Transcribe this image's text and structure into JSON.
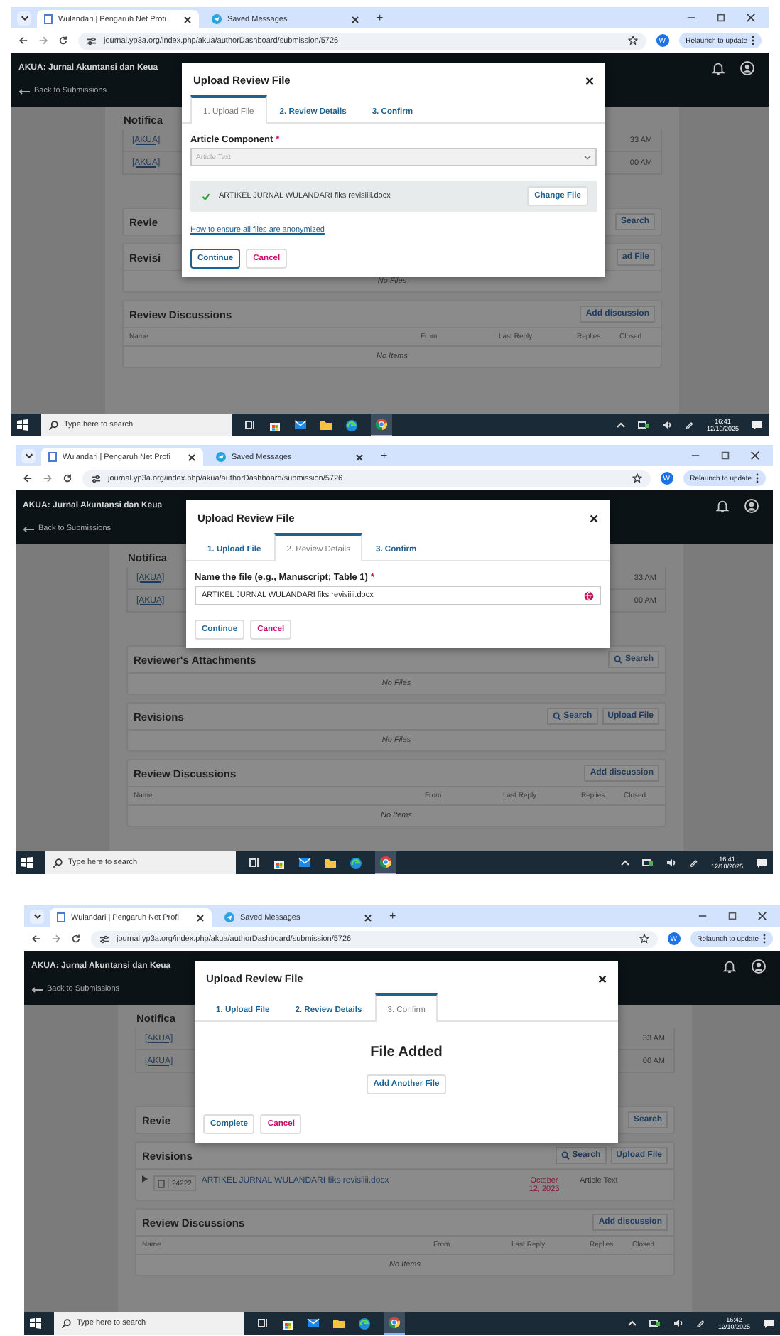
{
  "frames": [
    {
      "browser": {
        "tabs": [
          {
            "label": "Wulandari | Pengaruh Net Profi",
            "selected": true
          },
          {
            "label": "Saved Messages",
            "selected": false
          }
        ],
        "new_tab": "+",
        "url": "journal.yp3a.org/index.php/akua/authorDashboard/submission/5726",
        "profile": "W",
        "update": "Relaunch to update"
      },
      "page": {
        "title": "AKUA: Jurnal Akuntansi dan Keua",
        "back": "Back to Submissions",
        "cards": [
          {
            "kind": "notifications",
            "title": "Notifica",
            "rows": [
              {
                "link": "[AKUA]",
                "time": "33 AM"
              },
              {
                "link": "[AKUA]",
                "time": "00 AM"
              }
            ]
          },
          {
            "kind": "files",
            "title": "Revie",
            "buttons": [
              {
                "label": "Search",
                "kind": "plain"
              }
            ]
          },
          {
            "kind": "files",
            "title": "Revisi",
            "buttons": [
              {
                "label": "ad File",
                "kind": "plain"
              }
            ],
            "empty": "No Files"
          },
          {
            "kind": "discussions",
            "title": "Review Discussions",
            "buttons": [
              {
                "label": "Add discussion",
                "kind": "plain"
              }
            ],
            "columns": [
              "Name",
              "From",
              "Last Reply",
              "Replies",
              "Closed"
            ],
            "empty": "No Items"
          }
        ]
      },
      "modal": {
        "title": "Upload Review File",
        "steps": [
          {
            "label": "1. Upload File",
            "selected": true
          },
          {
            "label": "2. Review Details",
            "selected": false
          },
          {
            "label": "3. Confirm",
            "selected": false
          }
        ],
        "body": [
          {
            "kind": "select",
            "label": "Article Component",
            "required": "*",
            "value": "Article Text"
          },
          {
            "kind": "file",
            "name": "ARTIKEL JURNAL WULANDARI fiks revisiiii.docx",
            "button": "Change File"
          },
          {
            "kind": "link",
            "text": "How to ensure all files are anonymized"
          }
        ],
        "actions": [
          {
            "label": "Continue",
            "kind": "primary",
            "focused": true
          },
          {
            "label": "Cancel",
            "kind": "cancel",
            "focused": false
          }
        ]
      },
      "taskbar": {
        "search": "Type here to search",
        "time": "16:41",
        "date": "12/10/2025"
      }
    },
    {
      "browser": {
        "tabs": [
          {
            "label": "Wulandari | Pengaruh Net Profi",
            "selected": true
          },
          {
            "label": "Saved Messages",
            "selected": false
          }
        ],
        "new_tab": "+",
        "url": "journal.yp3a.org/index.php/akua/authorDashboard/submission/5726",
        "profile": "W",
        "update": "Relaunch to update"
      },
      "page": {
        "title": "AKUA: Jurnal Akuntansi dan Keua",
        "back": "Back to Submissions",
        "cards": [
          {
            "kind": "notifications",
            "title": "Notifica",
            "rows": [
              {
                "link": "[AKUA]",
                "time": "33 AM"
              },
              {
                "link": "[AKUA]",
                "time": "00 AM"
              }
            ]
          },
          {
            "kind": "files",
            "title": "Reviewer's Attachments",
            "buttons": [
              {
                "label": "Search",
                "kind": "search"
              }
            ],
            "empty": "No Files"
          },
          {
            "kind": "files",
            "title": "Revisions",
            "buttons": [
              {
                "label": "Search",
                "kind": "search"
              },
              {
                "label": "Upload File",
                "kind": "plain"
              }
            ],
            "empty": "No Files"
          },
          {
            "kind": "discussions",
            "title": "Review Discussions",
            "buttons": [
              {
                "label": "Add discussion",
                "kind": "plain"
              }
            ],
            "columns": [
              "Name",
              "From",
              "Last Reply",
              "Replies",
              "Closed"
            ],
            "empty": "No Items"
          }
        ]
      },
      "modal": {
        "title": "Upload Review File",
        "steps": [
          {
            "label": "1. Upload File",
            "selected": false
          },
          {
            "label": "2. Review Details",
            "selected": true
          },
          {
            "label": "3. Confirm",
            "selected": false
          }
        ],
        "body": [
          {
            "kind": "input",
            "label": "Name the file (e.g., Manuscript; Table 1)",
            "required": "*",
            "value": "ARTIKEL JURNAL WULANDARI fiks revisiiii.docx"
          }
        ],
        "actions": [
          {
            "label": "Continue",
            "kind": "primary",
            "focused": false
          },
          {
            "label": "Cancel",
            "kind": "cancel",
            "focused": false
          }
        ]
      },
      "taskbar": {
        "search": "Type here to search",
        "time": "16:41",
        "date": "12/10/2025"
      }
    },
    {
      "browser": {
        "tabs": [
          {
            "label": "Wulandari | Pengaruh Net Profi",
            "selected": true
          },
          {
            "label": "Saved Messages",
            "selected": false
          }
        ],
        "new_tab": "+",
        "url": "journal.yp3a.org/index.php/akua/authorDashboard/submission/5726",
        "profile": "W",
        "update": "Relaunch to update"
      },
      "page": {
        "title": "AKUA: Jurnal Akuntansi dan Keua",
        "back": "Back to Submissions",
        "cards": [
          {
            "kind": "notifications",
            "title": "Notifica",
            "rows": [
              {
                "link": "[AKUA]",
                "time": "33 AM"
              },
              {
                "link": "[AKUA]",
                "time": "00 AM"
              }
            ]
          },
          {
            "kind": "files",
            "title": "Revie",
            "buttons": [
              {
                "label": "Search",
                "kind": "plain"
              }
            ]
          },
          {
            "kind": "files",
            "title": "Revisions",
            "buttons": [
              {
                "label": "Search",
                "kind": "search"
              },
              {
                "label": "Upload File",
                "kind": "plain"
              }
            ],
            "files": [
              {
                "id": "24222",
                "name": "ARTIKEL JURNAL WULANDARI fiks revisiiii.docx",
                "date": "October 12, 2025",
                "component": "Article Text"
              }
            ]
          },
          {
            "kind": "discussions",
            "title": "Review Discussions",
            "buttons": [
              {
                "label": "Add discussion",
                "kind": "plain"
              }
            ],
            "columns": [
              "Name",
              "From",
              "Last Reply",
              "Replies",
              "Closed"
            ],
            "empty": "No Items"
          }
        ]
      },
      "modal": {
        "title": "Upload Review File",
        "steps": [
          {
            "label": "1. Upload File",
            "selected": false
          },
          {
            "label": "2. Review Details",
            "selected": false
          },
          {
            "label": "3. Confirm",
            "selected": true
          }
        ],
        "body": [
          {
            "kind": "heading",
            "text": "File Added"
          },
          {
            "kind": "button",
            "label": "Add Another File"
          }
        ],
        "actions": [
          {
            "label": "Complete",
            "kind": "primary",
            "focused": false
          },
          {
            "label": "Cancel",
            "kind": "cancel",
            "focused": false
          }
        ]
      },
      "taskbar": {
        "search": "Type here to search",
        "time": "16:42",
        "date": "12/10/2025"
      }
    }
  ]
}
